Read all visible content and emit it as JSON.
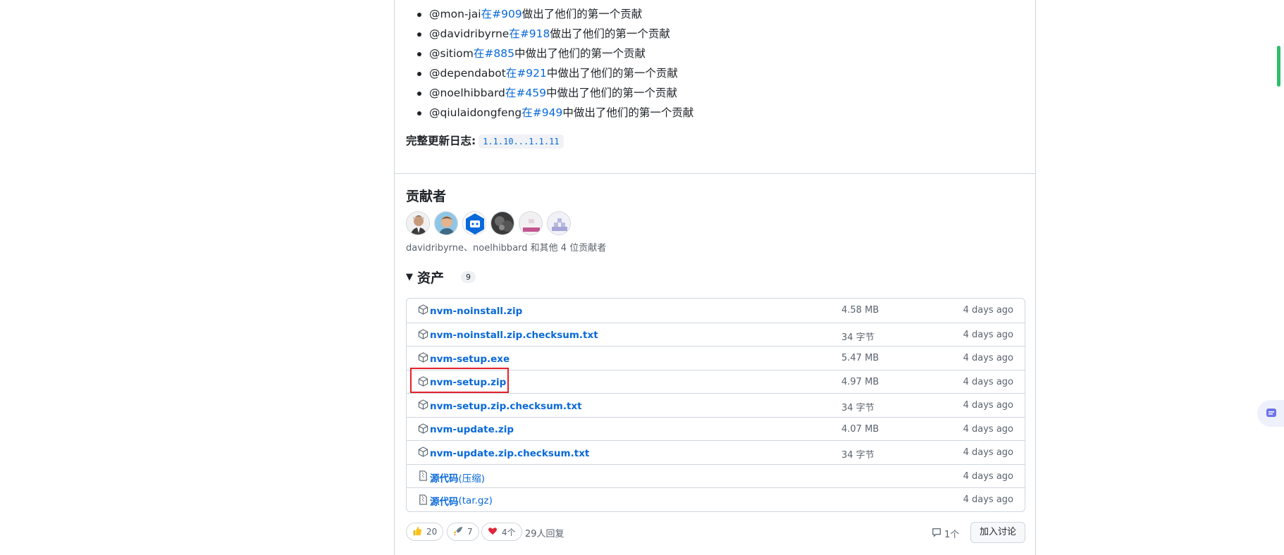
{
  "first_contributions": [
    {
      "user": "@mon-jai",
      "link": "在#909",
      "suffix": "做出了他们的第一个贡献"
    },
    {
      "user": "@davidribyrne",
      "link": "在#918",
      "suffix": "做出了他们的第一个贡献"
    },
    {
      "user": "@sitiom",
      "link": "在#885",
      "suffix": "中做出了他们的第一个贡献"
    },
    {
      "user": "@dependabot",
      "link": "在#921",
      "suffix": "中做出了他们的第一个贡献"
    },
    {
      "user": "@noelhibbard",
      "link": "在#459",
      "suffix": "中做出了他们的第一个贡献"
    },
    {
      "user": "@qiulaidongfeng",
      "link": "在#949",
      "suffix": "中做出了他们的第一个贡献"
    }
  ],
  "changelog": {
    "label": "完整更新日志:",
    "value": "1.1.10...1.1.11"
  },
  "contributors": {
    "title": "贡献者",
    "summary": "davidribyrne、noelhibbard 和其他 4 位贡献者"
  },
  "assets": {
    "title": "资产",
    "count": "9",
    "rows": [
      {
        "name": "nvm-noinstall.zip",
        "size": "4.58 MB",
        "date": "4 days ago",
        "icon": "package-icon"
      },
      {
        "name": "nvm-noinstall.zip.checksum.txt",
        "size": "34 字节",
        "date": "4 days ago",
        "icon": "package-icon"
      },
      {
        "name": "nvm-setup.exe",
        "size": "5.47 MB",
        "date": "4 days ago",
        "icon": "package-icon"
      },
      {
        "name": "nvm-setup.zip",
        "size": "4.97 MB",
        "date": "4 days ago",
        "icon": "package-icon"
      },
      {
        "name": "nvm-setup.zip.checksum.txt",
        "size": "34 字节",
        "date": "4 days ago",
        "icon": "package-icon"
      },
      {
        "name": "nvm-update.zip",
        "size": "4.07 MB",
        "date": "4 days ago",
        "icon": "package-icon"
      },
      {
        "name": "nvm-update.zip.checksum.txt",
        "size": "34 字节",
        "date": "4 days ago",
        "icon": "package-icon"
      },
      {
        "name": "源代码",
        "suffix": "(压缩)",
        "size": "",
        "date": "4 days ago",
        "icon": "file-zip-icon"
      },
      {
        "name": "源代码",
        "suffix": "(tar.gz)",
        "size": "",
        "date": "4 days ago",
        "icon": "file-zip-icon"
      }
    ]
  },
  "reactions": {
    "thumbs_up": "20",
    "rocket": "7",
    "heart": "4个",
    "replies": "29人回复"
  },
  "discussion": {
    "comments": "1个",
    "join_label": "加入讨论"
  },
  "colors": {
    "link": "#0969da",
    "highlight": "#e5202a",
    "scroll": "#2dbe6c"
  }
}
